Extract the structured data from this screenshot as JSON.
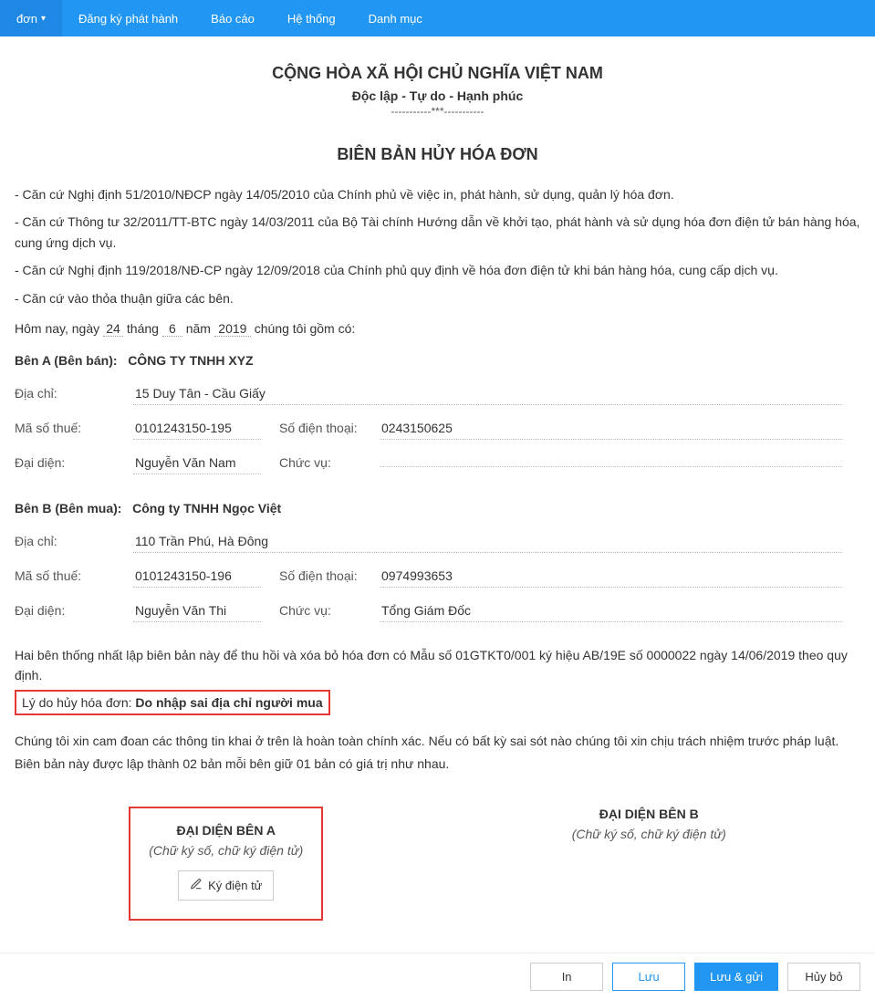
{
  "nav": {
    "items": [
      {
        "label": "đơn",
        "has_caret": true,
        "active": true
      },
      {
        "label": "Đăng ký phát hành",
        "has_caret": false,
        "active": false
      },
      {
        "label": "Báo cáo",
        "has_caret": false,
        "active": false
      },
      {
        "label": "Hệ thống",
        "has_caret": false,
        "active": false
      },
      {
        "label": "Danh mục",
        "has_caret": false,
        "active": false
      }
    ]
  },
  "header": {
    "national": "CỘNG HÒA XÃ HỘI CHỦ NGHĨA VIỆT NAM",
    "motto": "Độc lập - Tự do - Hạnh phúc",
    "line": "-----------***-----------"
  },
  "title": "BIÊN BẢN HỦY HÓA ĐƠN",
  "basis": [
    "- Căn cứ Nghị định 51/2010/NĐCP ngày 14/05/2010 của Chính phủ về việc in, phát hành, sử dụng, quản lý hóa đơn.",
    "- Căn cứ Thông tư 32/2011/TT-BTC ngày 14/03/2011 của Bộ Tài chính Hướng dẫn về khởi tạo, phát hành và sử dụng hóa đơn điện tử bán hàng hóa, cung ứng dịch vụ.",
    "- Căn cứ Nghị định 119/2018/NĐ-CP ngày 12/09/2018 của Chính phủ quy định về hóa đơn điện tử khi bán hàng hóa, cung cấp dịch vụ.",
    "- Căn cứ vào thỏa thuận giữa các bên."
  ],
  "date": {
    "prefix": "Hôm nay, ngày",
    "day": "24",
    "month_label": "tháng",
    "month": "6",
    "year_label": "năm",
    "year": "2019",
    "suffix": "chúng tôi gồm có:"
  },
  "labels": {
    "address": "Địa chỉ:",
    "tax": "Mã số thuế:",
    "phone": "Số điện thoại:",
    "rep": "Đại diện:",
    "position": "Chức vụ:"
  },
  "partyA": {
    "title": "Bên A (Bên bán):",
    "company": "CÔNG TY TNHH XYZ",
    "address": "15 Duy Tân - Cầu Giấy",
    "tax": "0101243150-195",
    "phone": "0243150625",
    "rep": "Nguyễn Văn Nam",
    "position": ""
  },
  "partyB": {
    "title": "Bên B (Bên mua):",
    "company": "Công ty TNHH Ngọc Việt",
    "address": "110 Trần Phú, Hà Đông",
    "tax": "0101243150-196",
    "phone": "0974993653",
    "rep": "Nguyễn Văn Thi",
    "position": "Tổng Giám Đốc"
  },
  "agreement": "Hai bên thống nhất lập biên bản này để thu hồi và xóa bỏ hóa đơn có Mẫu số 01GTKT0/001 ký hiệu AB/19E số 0000022 ngày 14/06/2019 theo quy định.",
  "reason": {
    "label": "Lý do hủy hóa đơn: ",
    "value": "Do nhập sai địa chỉ người mua"
  },
  "confirm": [
    "Chúng tôi xin cam đoan các thông tin khai ở trên là hoàn toàn chính xác. Nếu có bất kỳ sai sót nào chúng tôi xin chịu trách nhiệm trước pháp luật.",
    "Biên bản này được lập thành 02 bản mỗi bên giữ 01 bản có giá trị như nhau."
  ],
  "signatures": {
    "a": {
      "title": "ĐẠI DIỆN BÊN A",
      "sub": "(Chữ ký số, chữ ký điện tử)",
      "button": "Ký điện tử"
    },
    "b": {
      "title": "ĐẠI DIỆN BÊN B",
      "sub": "(Chữ ký số, chữ ký điện tử)"
    }
  },
  "footer": {
    "print": "In",
    "save": "Lưu",
    "save_send": "Lưu & gửi",
    "cancel": "Hủy bỏ"
  }
}
